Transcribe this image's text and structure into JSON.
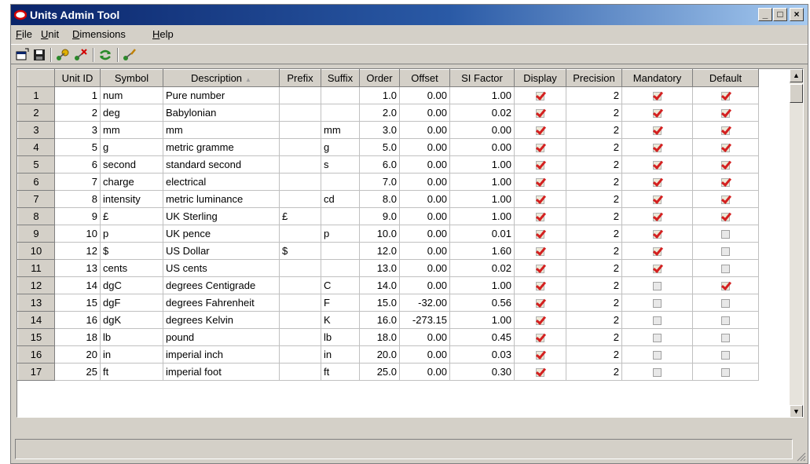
{
  "window": {
    "title": "Units Admin Tool",
    "controls": [
      "_",
      "□",
      "×"
    ]
  },
  "menu": [
    {
      "first": "F",
      "rest": "ile"
    },
    {
      "first": "U",
      "rest": "nit"
    },
    {
      "first": "D",
      "rest": "imensions"
    },
    {
      "first": "H",
      "rest": "elp"
    }
  ],
  "toolbar": {
    "icons": [
      "new-window-icon",
      "save-icon",
      "add-unit-icon",
      "delete-unit-icon",
      "refresh-icon",
      "edit-unit-icon"
    ]
  },
  "colors": {
    "title_start": "#0a246a",
    "title_end": "#a6caf0",
    "check": "#d42020",
    "chrome": "#d4d0c8"
  },
  "grid": {
    "columns": [
      "",
      "Unit ID",
      "Symbol",
      "Description",
      "Prefix",
      "Suffix",
      "Order",
      "Offset",
      "SI Factor",
      "Display",
      "Precision",
      "Mandatory",
      "Default"
    ],
    "sorted_column": "Description",
    "rows": [
      {
        "row": "1",
        "id": "1",
        "symbol": "num",
        "description": "Pure number",
        "prefix": "",
        "suffix": "",
        "order": "1.0",
        "offset": "0.00",
        "si": "1.00",
        "display": true,
        "precision": "2",
        "mandatory": true,
        "default": true
      },
      {
        "row": "2",
        "id": "2",
        "symbol": "deg",
        "description": "Babylonian",
        "prefix": "",
        "suffix": "",
        "order": "2.0",
        "offset": "0.00",
        "si": "0.02",
        "display": true,
        "precision": "2",
        "mandatory": true,
        "default": true
      },
      {
        "row": "3",
        "id": "3",
        "symbol": "mm",
        "description": "mm",
        "prefix": "",
        "suffix": "mm",
        "order": "3.0",
        "offset": "0.00",
        "si": "0.00",
        "display": true,
        "precision": "2",
        "mandatory": true,
        "default": true
      },
      {
        "row": "4",
        "id": "5",
        "symbol": "g",
        "description": "metric gramme",
        "prefix": "",
        "suffix": "g",
        "order": "5.0",
        "offset": "0.00",
        "si": "0.00",
        "display": true,
        "precision": "2",
        "mandatory": true,
        "default": true
      },
      {
        "row": "5",
        "id": "6",
        "symbol": "second",
        "description": "standard second",
        "prefix": "",
        "suffix": "s",
        "order": "6.0",
        "offset": "0.00",
        "si": "1.00",
        "display": true,
        "precision": "2",
        "mandatory": true,
        "default": true
      },
      {
        "row": "6",
        "id": "7",
        "symbol": "charge",
        "description": "electrical",
        "prefix": "",
        "suffix": "",
        "order": "7.0",
        "offset": "0.00",
        "si": "1.00",
        "display": true,
        "precision": "2",
        "mandatory": true,
        "default": true
      },
      {
        "row": "7",
        "id": "8",
        "symbol": "intensity",
        "description": "metric luminance",
        "prefix": "",
        "suffix": "cd",
        "order": "8.0",
        "offset": "0.00",
        "si": "1.00",
        "display": true,
        "precision": "2",
        "mandatory": true,
        "default": true
      },
      {
        "row": "8",
        "id": "9",
        "symbol": "£",
        "description": "UK Sterling",
        "prefix": "£",
        "suffix": "",
        "order": "9.0",
        "offset": "0.00",
        "si": "1.00",
        "display": true,
        "precision": "2",
        "mandatory": true,
        "default": true
      },
      {
        "row": "9",
        "id": "10",
        "symbol": "p",
        "description": "UK pence",
        "prefix": "",
        "suffix": "p",
        "order": "10.0",
        "offset": "0.00",
        "si": "0.01",
        "display": true,
        "precision": "2",
        "mandatory": true,
        "default": false
      },
      {
        "row": "10",
        "id": "12",
        "symbol": "$",
        "description": "US Dollar",
        "prefix": "$",
        "suffix": "",
        "order": "12.0",
        "offset": "0.00",
        "si": "1.60",
        "display": true,
        "precision": "2",
        "mandatory": true,
        "default": false
      },
      {
        "row": "11",
        "id": "13",
        "symbol": "cents",
        "description": "US cents",
        "prefix": "",
        "suffix": "",
        "order": "13.0",
        "offset": "0.00",
        "si": "0.02",
        "display": true,
        "precision": "2",
        "mandatory": true,
        "default": false
      },
      {
        "row": "12",
        "id": "14",
        "symbol": "dgC",
        "description": "degrees Centigrade",
        "prefix": "",
        "suffix": "C",
        "order": "14.0",
        "offset": "0.00",
        "si": "1.00",
        "display": true,
        "precision": "2",
        "mandatory": false,
        "default": true
      },
      {
        "row": "13",
        "id": "15",
        "symbol": "dgF",
        "description": "degrees Fahrenheit",
        "prefix": "",
        "suffix": "F",
        "order": "15.0",
        "offset": "-32.00",
        "si": "0.56",
        "display": true,
        "precision": "2",
        "mandatory": false,
        "default": false
      },
      {
        "row": "14",
        "id": "16",
        "symbol": "dgK",
        "description": "degrees Kelvin",
        "prefix": "",
        "suffix": "K",
        "order": "16.0",
        "offset": "-273.15",
        "si": "1.00",
        "display": true,
        "precision": "2",
        "mandatory": false,
        "default": false
      },
      {
        "row": "15",
        "id": "18",
        "symbol": "lb",
        "description": "pound",
        "prefix": "",
        "suffix": "lb",
        "order": "18.0",
        "offset": "0.00",
        "si": "0.45",
        "display": true,
        "precision": "2",
        "mandatory": false,
        "default": false
      },
      {
        "row": "16",
        "id": "20",
        "symbol": "in",
        "description": "imperial inch",
        "prefix": "",
        "suffix": "in",
        "order": "20.0",
        "offset": "0.00",
        "si": "0.03",
        "display": true,
        "precision": "2",
        "mandatory": false,
        "default": false
      },
      {
        "row": "17",
        "id": "25",
        "symbol": "ft",
        "description": "imperial foot",
        "prefix": "",
        "suffix": "ft",
        "order": "25.0",
        "offset": "0.00",
        "si": "0.30",
        "display": true,
        "precision": "2",
        "mandatory": false,
        "default": false
      }
    ]
  },
  "status": {
    "text": ""
  }
}
